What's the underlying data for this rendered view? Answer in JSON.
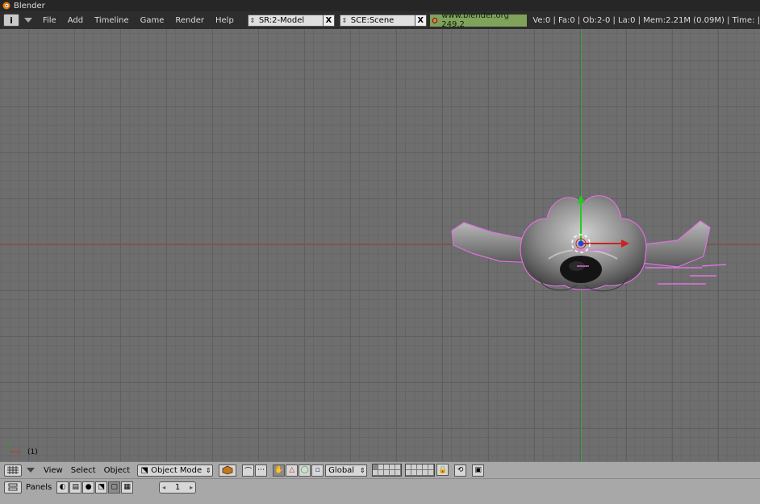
{
  "window": {
    "title": "Blender"
  },
  "infobar": {
    "menus": [
      "File",
      "Add",
      "Timeline",
      "Game",
      "Render",
      "Help"
    ],
    "screen": "SR:2-Model",
    "scene": "SCE:Scene",
    "url": "www.blender.org 249.2",
    "stats": "Ve:0 | Fa:0 | Ob:2-0 | La:0  | Mem:2.21M (0.09M)  | Time: |"
  },
  "viewport": {
    "frame": "(1)"
  },
  "header3d": {
    "menus": [
      "View",
      "Select",
      "Object"
    ],
    "mode": "Object Mode",
    "orientation": "Global"
  },
  "buttons": {
    "panels_label": "Panels",
    "frame_value": "1"
  },
  "colors": {
    "grid": "#6e6e6e",
    "axis_x": "#a04848",
    "axis_y": "#3fa83f",
    "selection": "#e070e0"
  }
}
